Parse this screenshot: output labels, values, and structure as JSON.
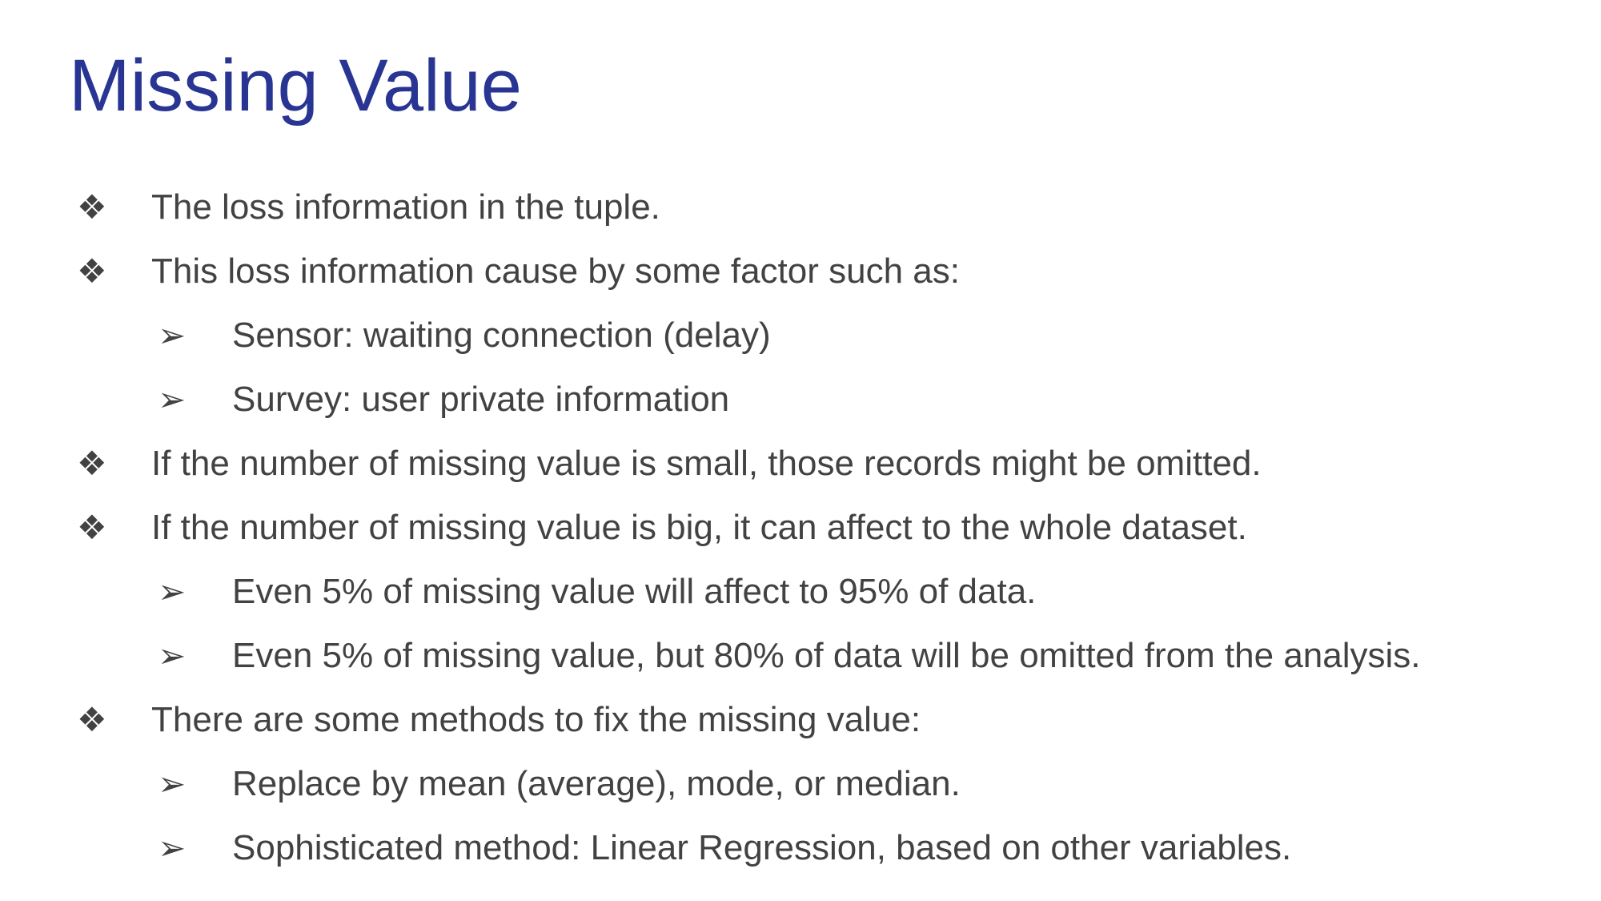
{
  "slide": {
    "title": "Missing Value",
    "colors": {
      "title": "#283593",
      "body_text": "#424242",
      "background": "#ffffff"
    },
    "markers": {
      "level1_icon": "four-diamond-bullet-icon",
      "level1_glyph": "❖",
      "level2_icon": "arrowhead-bullet-icon",
      "level2_glyph": "➢"
    },
    "bullets": [
      {
        "level": 1,
        "text": "The loss information in the tuple."
      },
      {
        "level": 1,
        "text": "This loss information cause by some factor such as:"
      },
      {
        "level": 2,
        "text": "Sensor: waiting connection (delay)"
      },
      {
        "level": 2,
        "text": "Survey: user private information"
      },
      {
        "level": 1,
        "text": "If the number of missing value is small, those records might be omitted."
      },
      {
        "level": 1,
        "text": "If the number of missing value is big, it can affect to the whole dataset."
      },
      {
        "level": 2,
        "text": "Even 5% of missing value will affect to 95% of data."
      },
      {
        "level": 2,
        "text": "Even 5% of missing value, but 80% of data will be omitted from the analysis."
      },
      {
        "level": 1,
        "text": "There are some methods to fix the missing value:"
      },
      {
        "level": 2,
        "text": "Replace by mean (average), mode, or median."
      },
      {
        "level": 2,
        "text": "Sophisticated method: Linear Regression, based on other variables."
      }
    ]
  }
}
